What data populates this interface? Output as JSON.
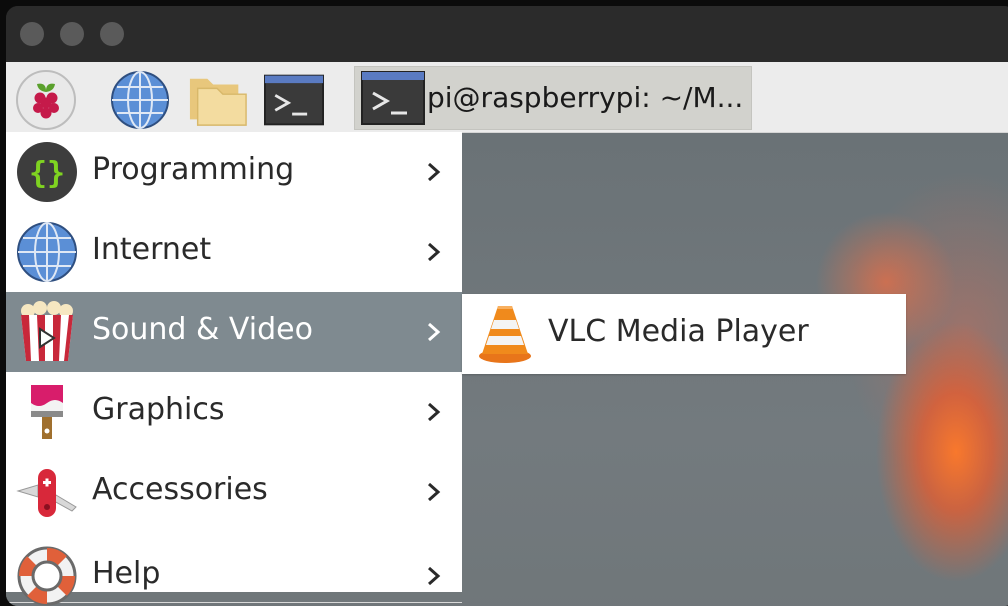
{
  "taskbar": {
    "launchers": [
      {
        "name": "raspberry-menu-button",
        "icon": "raspberry-icon"
      },
      {
        "name": "web-browser-launcher",
        "icon": "globe-icon"
      },
      {
        "name": "file-manager-launcher",
        "icon": "folder-icon"
      },
      {
        "name": "terminal-launcher",
        "icon": "terminal-icon"
      }
    ],
    "task": {
      "label": "pi@raspberrypi: ~/M...",
      "icon": "terminal-icon"
    }
  },
  "menu": {
    "items": [
      {
        "label": "Programming",
        "icon": "braces-icon"
      },
      {
        "label": "Internet",
        "icon": "globe-icon"
      },
      {
        "label": "Sound & Video",
        "icon": "popcorn-play-icon",
        "active": true
      },
      {
        "label": "Graphics",
        "icon": "paintbrush-icon"
      },
      {
        "label": "Accessories",
        "icon": "pocket-knife-icon"
      },
      {
        "label": "Help",
        "icon": "lifebuoy-icon"
      }
    ]
  },
  "submenu": {
    "items": [
      {
        "label": "VLC Media Player",
        "icon": "vlc-cone-icon"
      }
    ]
  },
  "colors": {
    "menu_highlight": "#7f8a90",
    "taskbar_bg": "#ececec",
    "window_chrome": "#2b2b2b"
  }
}
